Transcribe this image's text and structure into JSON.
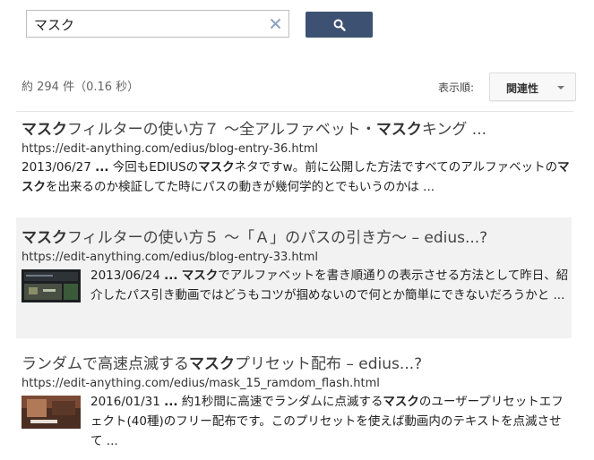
{
  "search": {
    "query": "マスク",
    "button_icon": "search-icon",
    "clear_icon": "close-icon"
  },
  "stats": {
    "text": "約 294 件（0.16 秒）"
  },
  "sort": {
    "label": "表示順:",
    "value": "関連性"
  },
  "colors": {
    "button": "#3d5272",
    "highlight": "#f2f2f2"
  },
  "results": [
    {
      "title": [
        {
          "t": "マスク",
          "b": true
        },
        {
          "t": "フィルターの使い方７ ～全アルファベット・",
          "b": false
        },
        {
          "t": "マスク",
          "b": true
        },
        {
          "t": "キング ...",
          "b": false
        }
      ],
      "url": "https://edit-anything.com/edius/blog-entry-36.html",
      "date": "2013/06/27",
      "snippet": [
        {
          "t": " ",
          "b": false
        },
        {
          "t": "...",
          "b": true
        },
        {
          "t": " 今回もEDIUSの",
          "b": false
        },
        {
          "t": "マスク",
          "b": true
        },
        {
          "t": "ネタですw。前に公開した方法ですべてのアルファベットの",
          "b": false
        },
        {
          "t": "マスク",
          "b": true
        },
        {
          "t": "を出来るのか検証してた時にパスの動きが幾何学的とでもいうのかは ...",
          "b": false
        }
      ]
    },
    {
      "title": [
        {
          "t": "マスク",
          "b": true
        },
        {
          "t": "フィルターの使い方５ ～「Ａ」のパスの引き方～ – edius...?",
          "b": false
        }
      ],
      "url": "https://edit-anything.com/edius/blog-entry-33.html",
      "date": "2013/06/24",
      "thumbnail": "video-thumbnail-dark",
      "snippet": [
        {
          "t": " ",
          "b": false
        },
        {
          "t": "...",
          "b": true
        },
        {
          "t": " ",
          "b": false
        },
        {
          "t": "マスク",
          "b": true
        },
        {
          "t": "でアルファベットを書き順通りの表示させる方法として昨日、紹介したパス引き動画ではどうもコツが掴めないので何とか簡単にできないだろうかと ...",
          "b": false
        }
      ]
    },
    {
      "title": [
        {
          "t": "ランダムで高速点滅する",
          "b": false
        },
        {
          "t": "マスク",
          "b": true
        },
        {
          "t": "プリセット配布 – edius...?",
          "b": false
        }
      ],
      "url": "https://edit-anything.com/edius/mask_15_ramdom_flash.html",
      "date": "2016/01/31",
      "thumbnail": "video-thumbnail-brown",
      "snippet": [
        {
          "t": " ",
          "b": false
        },
        {
          "t": "...",
          "b": true
        },
        {
          "t": " 約1秒間に高速でランダムに点滅する",
          "b": false
        },
        {
          "t": "マスク",
          "b": true
        },
        {
          "t": "のユーザープリセットエフェクト(40種)のフリー配布です。このプリセットを使えば動画内のテキストを点滅させて ...",
          "b": false
        }
      ]
    }
  ]
}
